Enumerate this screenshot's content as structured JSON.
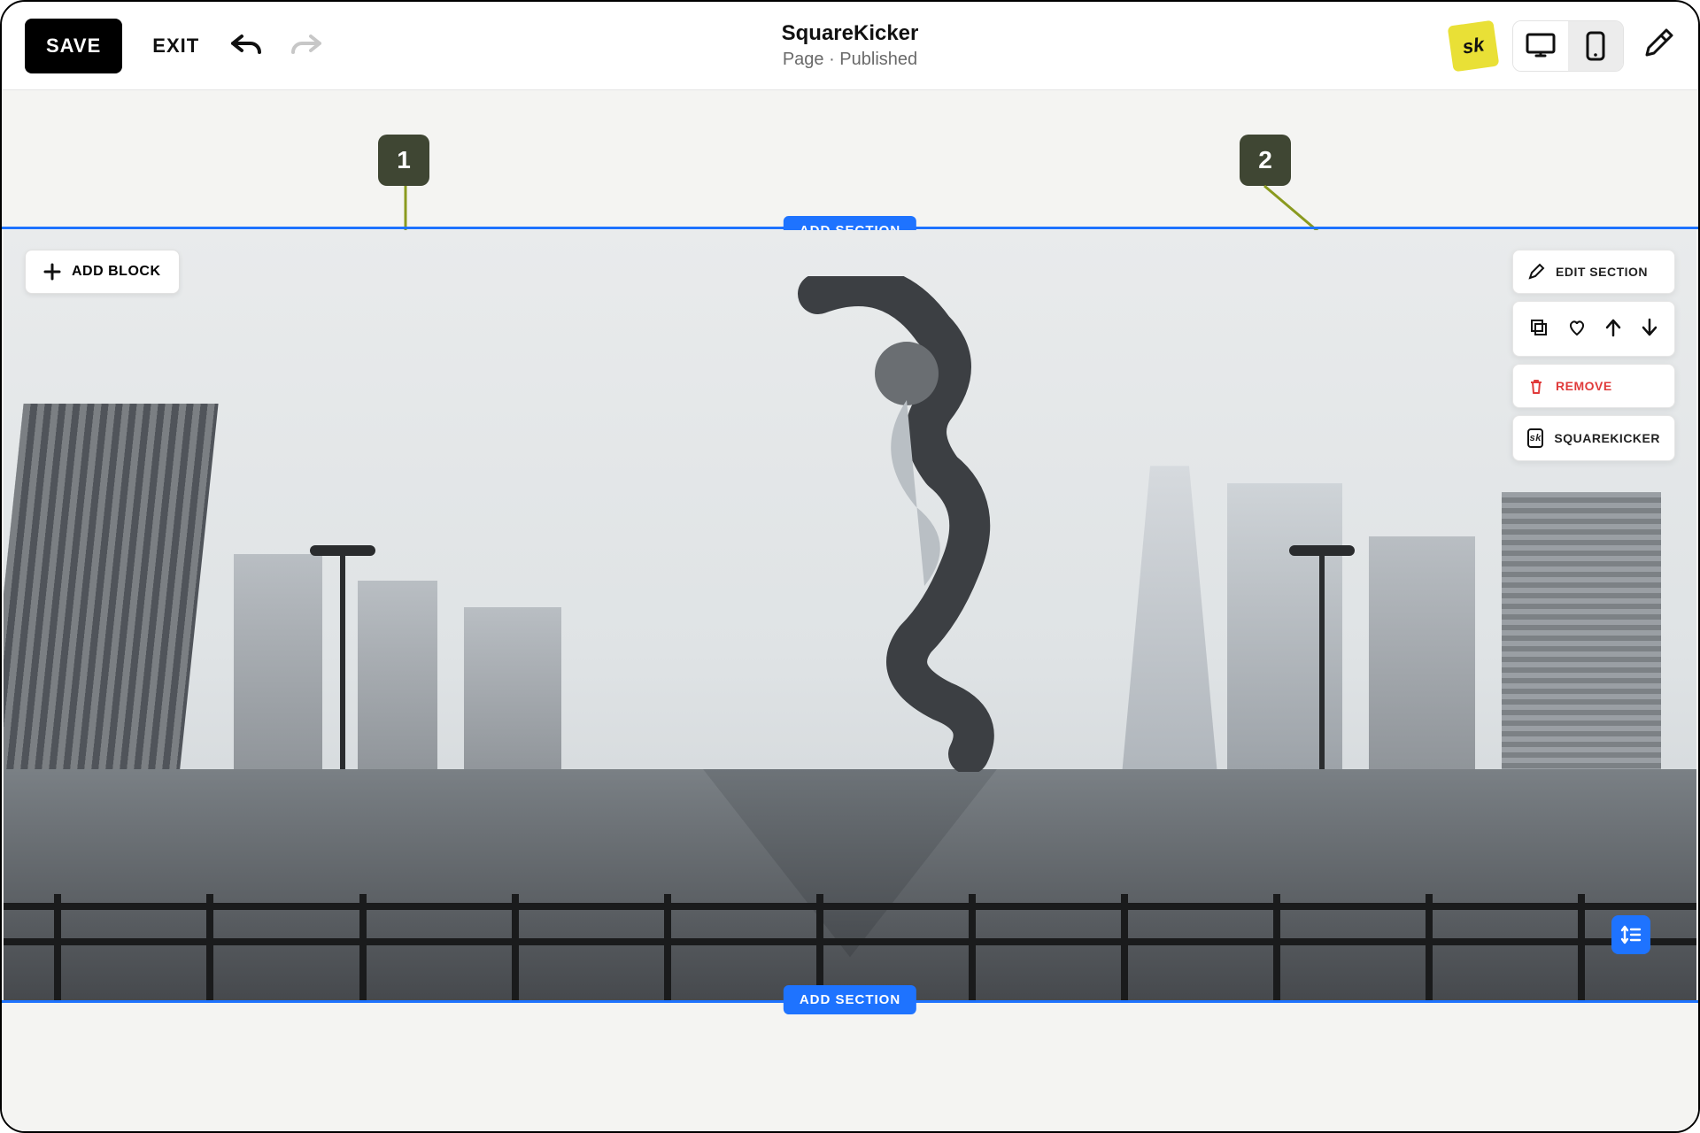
{
  "header": {
    "save_label": "SAVE",
    "exit_label": "EXIT",
    "title": "SquareKicker",
    "subtitle": "Page · Published",
    "sk_logo_text": "sk"
  },
  "annotations": {
    "badge1": "1",
    "badge2": "2"
  },
  "canvas": {
    "add_section_label": "ADD SECTION",
    "add_block_label": "ADD BLOCK"
  },
  "context_menu": {
    "edit_section": "EDIT SECTION",
    "remove": "REMOVE",
    "squarekicker": "SQUAREKICKER",
    "sk_mini_text": "sk"
  }
}
